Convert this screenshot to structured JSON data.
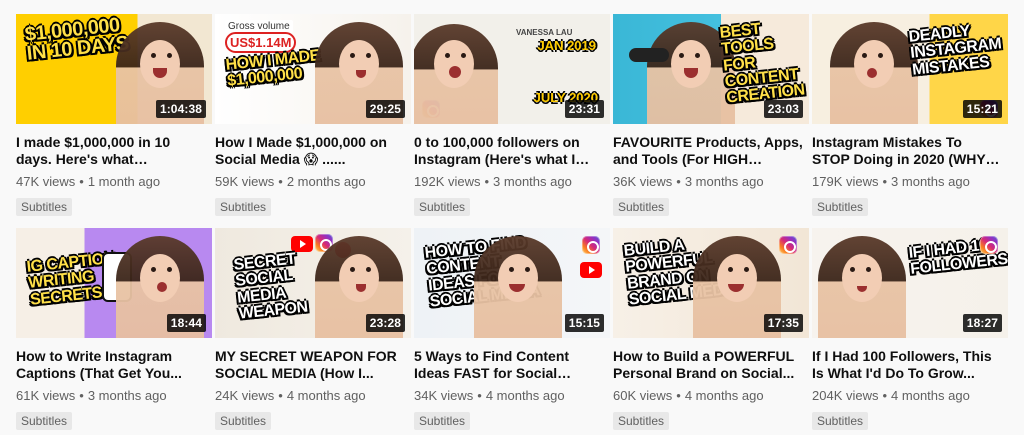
{
  "videos": [
    {
      "title": "I made $1,000,000 in 10 days. Here's what happened.",
      "views": "47K views",
      "age": "1 month ago",
      "tag": "Subtitles",
      "duration": "1:04:38",
      "thumb_text": "$1,000,000 IN 10 DAYS",
      "thumb_style": {
        "bg": "#ffc400",
        "text": "yellow"
      }
    },
    {
      "title": "How I Made $1,000,000 on Social Media 😱 ......",
      "views": "59K views",
      "age": "2 months ago",
      "tag": "Subtitles",
      "duration": "29:25",
      "thumb_text": "HOW I MADE $1,000,000",
      "thumb_extra": {
        "gross_label": "Gross volume",
        "gross_value": "US$1.14M"
      },
      "thumb_style": {
        "bg": "#f6f2ec",
        "text": "yellow"
      }
    },
    {
      "title": "0 to 100,000 followers on Instagram (Here's what I did.)",
      "views": "192K views",
      "age": "3 months ago",
      "tag": "Subtitles",
      "duration": "23:31",
      "thumb_extra": {
        "name": "VANESSA LAU",
        "date_top": "JAN 2019",
        "date_bottom": "JULY 2020"
      },
      "thumb_style": {
        "bg": "#f1efe9",
        "text": "yellow"
      }
    },
    {
      "title": "FAVOURITE Products, Apps, and Tools (For HIGH QUALI...",
      "views": "36K views",
      "age": "3 months ago",
      "tag": "Subtitles",
      "duration": "23:03",
      "thumb_text": "BEST TOOLS FOR CONTENT CREATION",
      "thumb_style": {
        "bg": "#42b9d6",
        "text": "yellow"
      }
    },
    {
      "title": "Instagram Mistakes To STOP Doing in 2020 (WHY YOU...",
      "views": "179K views",
      "age": "3 months ago",
      "tag": "Subtitles",
      "duration": "15:21",
      "thumb_text": "DEADLY INSTAGRAM MISTAKES",
      "thumb_style": {
        "bg": "#ffd341",
        "text": "white"
      }
    },
    {
      "title": "How to Write Instagram Captions (That Get You...",
      "views": "61K views",
      "age": "3 months ago",
      "tag": "Subtitles",
      "duration": "18:44",
      "thumb_text": "IG CAPTION WRITING SECRETS",
      "thumb_style": {
        "bg": "#b889f0",
        "text": "yellow"
      }
    },
    {
      "title": "MY SECRET WEAPON FOR SOCIAL MEDIA (How I...",
      "views": "24K views",
      "age": "4 months ago",
      "tag": "Subtitles",
      "duration": "23:28",
      "thumb_text": "SECRET SOCIAL MEDIA WEAPON",
      "thumb_style": {
        "bg": "#f2efe8",
        "text": "white"
      }
    },
    {
      "title": "5 Ways to Find Content Ideas FAST for Social Media...",
      "views": "34K views",
      "age": "4 months ago",
      "tag": "Subtitles",
      "duration": "15:15",
      "thumb_text": "HOW TO FIND CONTENT IDEAS FOR SOCIAL MEDIA",
      "thumb_style": {
        "bg": "#f0f4f7",
        "text": "white"
      }
    },
    {
      "title": "How to Build a POWERFUL Personal Brand on Social...",
      "views": "60K views",
      "age": "4 months ago",
      "tag": "Subtitles",
      "duration": "17:35",
      "thumb_text": "BUILD A POWERFUL BRAND ON SOCIAL MEDIA",
      "thumb_style": {
        "bg": "#f4e8d9",
        "text": "white"
      }
    },
    {
      "title": "If I Had 100 Followers, This Is What I'd Do To Grow...",
      "views": "204K views",
      "age": "4 months ago",
      "tag": "Subtitles",
      "duration": "18:27",
      "thumb_text": "IF I HAD 100 FOLLOWERS...",
      "thumb_style": {
        "bg": "#f5f1ea",
        "text": "white"
      }
    }
  ]
}
